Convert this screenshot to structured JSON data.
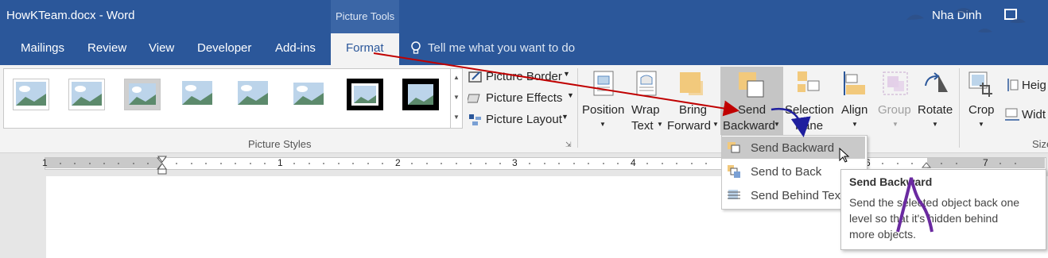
{
  "window": {
    "title": "HowKTeam.docx - Word",
    "user": "Nha Dinh",
    "context_group": "Picture Tools"
  },
  "tabs": [
    {
      "label": "Mailings"
    },
    {
      "label": "Review"
    },
    {
      "label": "View"
    },
    {
      "label": "Developer"
    },
    {
      "label": "Add-ins"
    },
    {
      "label": "Format",
      "active": true
    }
  ],
  "tell_me": {
    "placeholder": "Tell me what you want to do"
  },
  "picture_styles": {
    "group_label": "Picture Styles",
    "commands": {
      "border": "Picture Border",
      "effects": "Picture Effects",
      "layout": "Picture Layout"
    }
  },
  "arrange": {
    "position": "Position",
    "wrap_text": {
      "line1": "Wrap",
      "line2": "Text"
    },
    "bring_forward": {
      "line1": "Bring",
      "line2": "Forward"
    },
    "send_backward": {
      "line1": "Send",
      "line2": "Backward"
    },
    "selection_pane": {
      "line1": "Selection",
      "line2": "Pane"
    },
    "align": "Align",
    "group": "Group",
    "rotate": "Rotate"
  },
  "size": {
    "crop": "Crop",
    "height": "Heig",
    "width": "Widt",
    "group_label": "Size"
  },
  "ruler": {
    "labels": [
      "1",
      "1",
      "2",
      "3",
      "4",
      "6",
      "7"
    ]
  },
  "dropdown": {
    "items": [
      {
        "label": "Send Backward",
        "highlighted": true
      },
      {
        "label": "Send to Back"
      },
      {
        "label": "Send Behind Text"
      }
    ]
  },
  "tooltip": {
    "title": "Send Backward",
    "line1": "Send the selected object back one",
    "line2": "level so that it's hidden behind",
    "line3": "more objects."
  },
  "colors": {
    "ribbon_blue": "#2b579a",
    "annotation_arrow_red": "#c00000",
    "annotation_arrow_blue": "#1f1f9e",
    "annotation_mark": "#6a2aa0"
  }
}
